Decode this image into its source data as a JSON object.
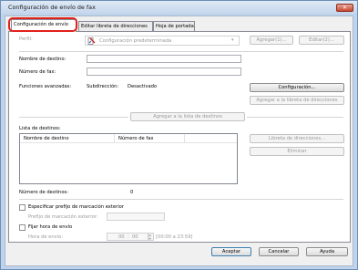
{
  "window": {
    "title": "Configuración de envío de fax",
    "close_glyph": "✕"
  },
  "tabs": [
    {
      "label": "Configuración de envío"
    },
    {
      "label": "Editar libreta de direcciones"
    },
    {
      "label": "Hoja de portada"
    }
  ],
  "profile": {
    "label": "Perfil:",
    "value": "Configuración predeterminada",
    "add_button": "Agregar(1)...",
    "edit_button": "Editar(2)..."
  },
  "fields": {
    "destination_name_label": "Nombre de destino:",
    "destination_name_value": "",
    "fax_number_label": "Número de fax:",
    "fax_number_value": ""
  },
  "advanced": {
    "label": "Funciones avanzadas:",
    "subaddress_label": "Subdirección:",
    "subaddress_value": "Desactivado",
    "configure_button": "Configuración...",
    "add_to_addressbook_button": "Agregar a la libreta de direcciones"
  },
  "add_to_list_button": "Agregar a la lista de destinos",
  "destinations": {
    "label": "Lista de destinos:",
    "columns": [
      "Nombre de destino",
      "Número de fax"
    ],
    "rows": [],
    "address_book_button": "Libreta de direcciones...",
    "delete_button": "Eliminar",
    "count_label": "Número de destinos:",
    "count_value": "0"
  },
  "outside_prefix": {
    "checkbox_label": "Especificar prefijo de marcación exterior",
    "field_label": "Prefijo de marcación exterior:",
    "value": ""
  },
  "send_time": {
    "checkbox_label": "Fijar hora de envío",
    "field_label": "Hora de envío:",
    "hour": "00",
    "minute": "00",
    "separator": ":",
    "range_hint": "[00:00 a 23:59]"
  },
  "footer": {
    "accept": "Aceptar",
    "cancel": "Cancelar",
    "help": "Ayuda"
  },
  "colors": {
    "highlight": "#e0211b",
    "titlebar": "#c4d6ec"
  }
}
